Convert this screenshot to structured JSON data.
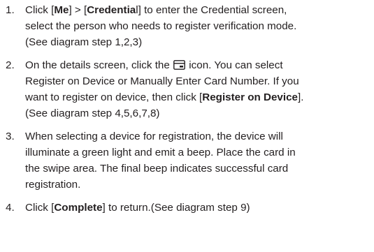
{
  "steps": [
    {
      "number": "1.",
      "l1_a": "Click [",
      "l1_me": "Me",
      "l1_b": "] > [",
      "l1_cred": "Credentia",
      "l1_c": "l] to enter the Credential screen,",
      "l2": "select the person who needs to register verification mode.",
      "l3": "(See diagram step 1,2,3)"
    },
    {
      "number": "2.",
      "l1_a": "On the details screen, click the",
      "icon": "card-icon",
      "l1_b": "icon. You can select",
      "l2": "Register on Device or Manually Enter Card Number. If you",
      "l3_a": "want to register on device, then click [",
      "l3_bold": "Register on Device",
      "l3_b": "].",
      "l4": "(See diagram step 4,5,6,7,8)"
    },
    {
      "number": "3.",
      "l1": "When selecting a device for registration, the device will",
      "l2": "illuminate a green light and emit a beep. Place the card in",
      "l3": "the swipe area. The final beep indicates successful card",
      "l4": "registration."
    },
    {
      "number": "4.",
      "l1_a": "Click [",
      "l1_bold": "Complete",
      "l1_b": "] to return.(See diagram step 9)"
    }
  ]
}
